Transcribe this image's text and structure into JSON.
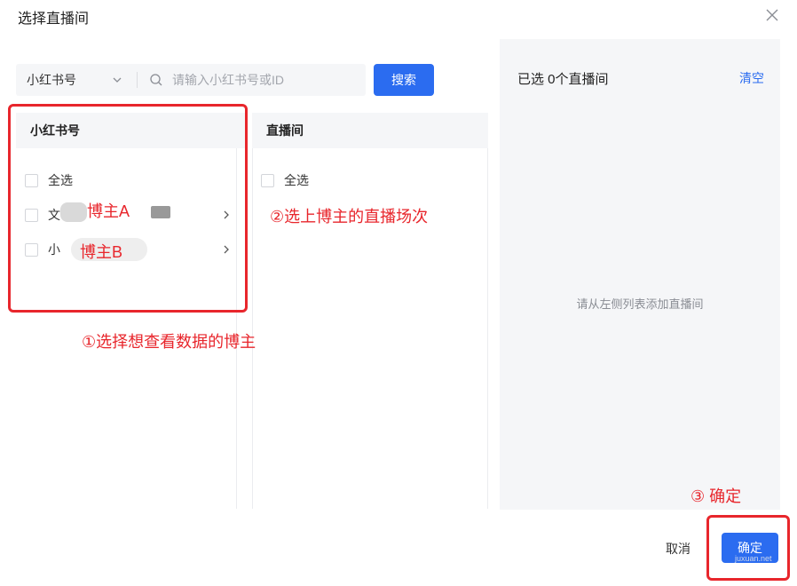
{
  "dialog": {
    "title": "选择直播间"
  },
  "search": {
    "platform": "小红书号",
    "placeholder": "请输入小红书号或ID",
    "button_label": "搜索"
  },
  "columns": {
    "bloggers_header": "小红书号",
    "rooms_header": "直播间"
  },
  "bloggers": {
    "select_all": "全选",
    "items": [
      {
        "label_prefix": "文",
        "tag": "博主A"
      },
      {
        "label_prefix": "小",
        "tag": "博主B"
      }
    ]
  },
  "rooms": {
    "select_all": "全选"
  },
  "selected_panel": {
    "count_label": "已选 0个直播间",
    "clear_label": "清空",
    "empty_hint": "请从左侧列表添加直播间"
  },
  "footer": {
    "cancel_label": "取消",
    "confirm_label": "确定",
    "watermark": "juxuan.net"
  },
  "annotations": {
    "step1": "①选择想查看数据的博主",
    "step2": "②选上博主的直播场次",
    "step3": "③ 确定"
  },
  "colors": {
    "accent": "#2b6cf0",
    "annotation": "#e8262c",
    "panel_bg": "#f5f6f8"
  }
}
